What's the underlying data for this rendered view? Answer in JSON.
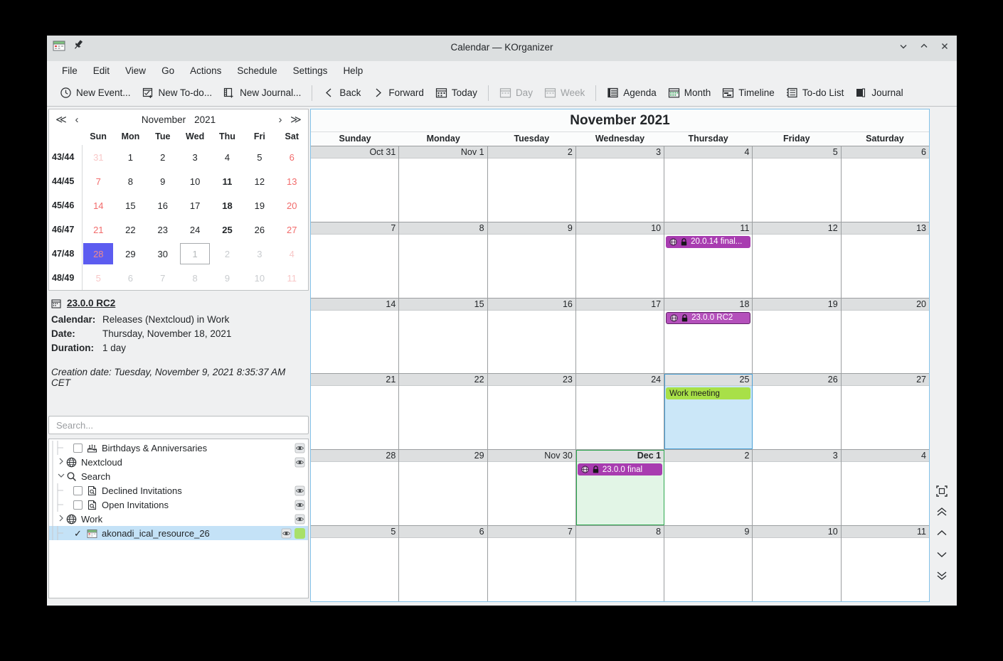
{
  "window": {
    "title": "Calendar — KOrganizer",
    "app_icon": "calendar-icon",
    "pin_icon": "pin-icon",
    "buttons": [
      {
        "name": "minimize-button",
        "glyph": "chevron-down-icon"
      },
      {
        "name": "maximize-button",
        "glyph": "chevron-up-icon"
      },
      {
        "name": "close-button",
        "glyph": "close-icon"
      }
    ]
  },
  "menubar": {
    "items": [
      {
        "label": "File"
      },
      {
        "label": "Edit"
      },
      {
        "label": "View"
      },
      {
        "label": "Go"
      },
      {
        "label": "Actions"
      },
      {
        "label": "Schedule"
      },
      {
        "label": "Settings"
      },
      {
        "label": "Help"
      }
    ]
  },
  "toolbar": {
    "items": [
      {
        "label": "New Event...",
        "icon": "clock-icon",
        "disabled": false
      },
      {
        "label": "New To-do...",
        "icon": "todo-icon",
        "disabled": false
      },
      {
        "label": "New Journal...",
        "icon": "journal-new-icon",
        "disabled": false
      },
      {
        "label": "Back",
        "icon": "chevron-left-icon",
        "disabled": false
      },
      {
        "label": "Forward",
        "icon": "chevron-right-icon",
        "disabled": false
      },
      {
        "label": "Today",
        "icon": "calendar-today-icon",
        "disabled": false
      },
      {
        "label": "Day",
        "icon": "calendar-day-icon",
        "disabled": true
      },
      {
        "label": "Week",
        "icon": "calendar-week-icon",
        "disabled": true
      },
      {
        "label": "Agenda",
        "icon": "agenda-icon",
        "disabled": false
      },
      {
        "label": "Month",
        "icon": "calendar-month-icon",
        "disabled": false
      },
      {
        "label": "Timeline",
        "icon": "timeline-icon",
        "disabled": false
      },
      {
        "label": "To-do List",
        "icon": "todo-list-icon",
        "disabled": false
      },
      {
        "label": "Journal",
        "icon": "journal-icon",
        "disabled": false
      }
    ]
  },
  "minicalendar": {
    "month": "November",
    "year": "2021",
    "nav": {
      "prev_year": "double-chevron-left-icon",
      "prev_month": "chevron-left-icon",
      "next_month": "chevron-right-icon",
      "next_year": "double-chevron-right-icon"
    },
    "weekday_headers": [
      "Sun",
      "Mon",
      "Tue",
      "Wed",
      "Thu",
      "Fri",
      "Sat"
    ],
    "rows": [
      {
        "week": "43/44",
        "days": [
          {
            "d": "31",
            "weekend": true,
            "other": true
          },
          {
            "d": "1"
          },
          {
            "d": "2"
          },
          {
            "d": "3"
          },
          {
            "d": "4"
          },
          {
            "d": "5"
          },
          {
            "d": "6",
            "weekend": true
          }
        ]
      },
      {
        "week": "44/45",
        "days": [
          {
            "d": "7",
            "weekend": true
          },
          {
            "d": "8"
          },
          {
            "d": "9"
          },
          {
            "d": "10"
          },
          {
            "d": "11",
            "bold": true
          },
          {
            "d": "12"
          },
          {
            "d": "13",
            "weekend": true
          }
        ]
      },
      {
        "week": "45/46",
        "days": [
          {
            "d": "14",
            "weekend": true
          },
          {
            "d": "15"
          },
          {
            "d": "16"
          },
          {
            "d": "17"
          },
          {
            "d": "18",
            "bold": true
          },
          {
            "d": "19"
          },
          {
            "d": "20",
            "weekend": true
          }
        ]
      },
      {
        "week": "46/47",
        "days": [
          {
            "d": "21",
            "weekend": true
          },
          {
            "d": "22"
          },
          {
            "d": "23"
          },
          {
            "d": "24"
          },
          {
            "d": "25",
            "bold": true
          },
          {
            "d": "26"
          },
          {
            "d": "27",
            "weekend": true
          }
        ]
      },
      {
        "week": "47/48",
        "days": [
          {
            "d": "28",
            "weekend": true,
            "selected": true
          },
          {
            "d": "29"
          },
          {
            "d": "30"
          },
          {
            "d": "1",
            "other": true,
            "today": true
          },
          {
            "d": "2",
            "other": true
          },
          {
            "d": "3",
            "other": true
          },
          {
            "d": "4",
            "weekend": true,
            "other": true
          }
        ]
      },
      {
        "week": "48/49",
        "days": [
          {
            "d": "5",
            "weekend": true,
            "other": true
          },
          {
            "d": "6",
            "other": true
          },
          {
            "d": "7",
            "other": true
          },
          {
            "d": "8",
            "other": true
          },
          {
            "d": "9",
            "other": true
          },
          {
            "d": "10",
            "other": true
          },
          {
            "d": "11",
            "weekend": true,
            "other": true
          }
        ]
      }
    ]
  },
  "details": {
    "icon": "calendar-event-icon",
    "title": "23.0.0 RC2",
    "fields": [
      {
        "key": "Calendar:",
        "value": "Releases (Nextcloud) in Work"
      },
      {
        "key": "Date:",
        "value": "Thursday, November 18, 2021"
      },
      {
        "key": "Duration:",
        "value": "1 day"
      }
    ],
    "creation": "Creation date: Tuesday, November 9, 2021 8:35:37 AM CET"
  },
  "search": {
    "placeholder": "Search...",
    "value": ""
  },
  "collections": [
    {
      "label": "Birthdays & Anniversaries",
      "indent": 1,
      "checkbox": "unchecked",
      "icon": "cake-icon",
      "expander": "",
      "eye": true
    },
    {
      "label": "Nextcloud",
      "indent": 0,
      "checkbox": "none",
      "icon": "globe-icon",
      "expander": "collapsed",
      "eye": true
    },
    {
      "label": "Search",
      "indent": 0,
      "checkbox": "none",
      "icon": "magnifier-icon",
      "expander": "expanded",
      "eye": false
    },
    {
      "label": "Declined Invitations",
      "indent": 1,
      "checkbox": "unchecked",
      "icon": "document-search-icon",
      "expander": "",
      "eye": true
    },
    {
      "label": "Open Invitations",
      "indent": 1,
      "checkbox": "unchecked",
      "icon": "document-search-icon",
      "expander": "",
      "eye": true
    },
    {
      "label": "Work",
      "indent": 0,
      "checkbox": "none",
      "icon": "globe-icon",
      "expander": "collapsed",
      "eye": true
    },
    {
      "label": "akonadi_ical_resource_26",
      "indent": 1,
      "checkbox": "checked",
      "icon": "calendar-icon",
      "expander": "",
      "eye": true,
      "selected": true,
      "color": "#a8e06a"
    }
  ],
  "monthview": {
    "title": "November 2021",
    "weekday_headers": [
      "Sunday",
      "Monday",
      "Tuesday",
      "Wednesday",
      "Thursday",
      "Friday",
      "Saturday"
    ],
    "weeks": [
      [
        {
          "label": "Oct 31",
          "events": []
        },
        {
          "label": "Nov 1",
          "events": []
        },
        {
          "label": "2",
          "events": []
        },
        {
          "label": "3",
          "events": []
        },
        {
          "label": "4",
          "events": []
        },
        {
          "label": "5",
          "events": []
        },
        {
          "label": "6",
          "events": []
        }
      ],
      [
        {
          "label": "7",
          "events": []
        },
        {
          "label": "8",
          "events": []
        },
        {
          "label": "9",
          "events": []
        },
        {
          "label": "10",
          "events": []
        },
        {
          "label": "11",
          "events": [
            {
              "text": "20.0.14 final...",
              "color": "#a83cb0",
              "icons": [
                "globe-icon",
                "lock-icon"
              ]
            }
          ]
        },
        {
          "label": "12",
          "events": []
        },
        {
          "label": "13",
          "events": []
        }
      ],
      [
        {
          "label": "14",
          "events": []
        },
        {
          "label": "15",
          "events": []
        },
        {
          "label": "16",
          "events": []
        },
        {
          "label": "17",
          "events": []
        },
        {
          "label": "18",
          "events": [
            {
              "text": "23.0.0 RC2",
              "color": "#b450bb",
              "icons": [
                "globe-icon",
                "lock-icon"
              ],
              "selected": true
            }
          ]
        },
        {
          "label": "19",
          "events": []
        },
        {
          "label": "20",
          "events": []
        }
      ],
      [
        {
          "label": "21",
          "events": []
        },
        {
          "label": "22",
          "events": []
        },
        {
          "label": "23",
          "events": []
        },
        {
          "label": "24",
          "events": []
        },
        {
          "label": "25",
          "events": [
            {
              "text": "Work meeting",
              "color": "#a8e048",
              "textcolor": "#1c1c1c"
            }
          ],
          "selected": true
        },
        {
          "label": "26",
          "events": []
        },
        {
          "label": "27",
          "events": []
        }
      ],
      [
        {
          "label": "28",
          "events": []
        },
        {
          "label": "29",
          "events": []
        },
        {
          "label": "Nov 30",
          "events": []
        },
        {
          "label": "Dec 1",
          "events": [
            {
              "text": "23.0.0 final",
              "color": "#a83cb0",
              "icons": [
                "globe-icon",
                "lock-icon"
              ]
            }
          ],
          "today": true
        },
        {
          "label": "2",
          "events": []
        },
        {
          "label": "3",
          "events": []
        },
        {
          "label": "4",
          "events": []
        }
      ],
      [
        {
          "label": "5",
          "events": []
        },
        {
          "label": "6",
          "events": []
        },
        {
          "label": "7",
          "events": []
        },
        {
          "label": "8",
          "events": []
        },
        {
          "label": "9",
          "events": []
        },
        {
          "label": "10",
          "events": []
        },
        {
          "label": "11",
          "events": []
        }
      ]
    ]
  },
  "rightstrip": {
    "buttons": [
      {
        "name": "fit-icon"
      },
      {
        "name": "double-chevron-up-icon"
      },
      {
        "name": "chevron-up-icon"
      },
      {
        "name": "chevron-down-icon"
      },
      {
        "name": "double-chevron-down-icon"
      }
    ]
  },
  "colors": {
    "selection_blue": "#5c5cf0",
    "today_green": "#2ea84f",
    "event_purple": "#a83cb0",
    "event_green": "#a8e048",
    "panel": "#eff0f1"
  }
}
